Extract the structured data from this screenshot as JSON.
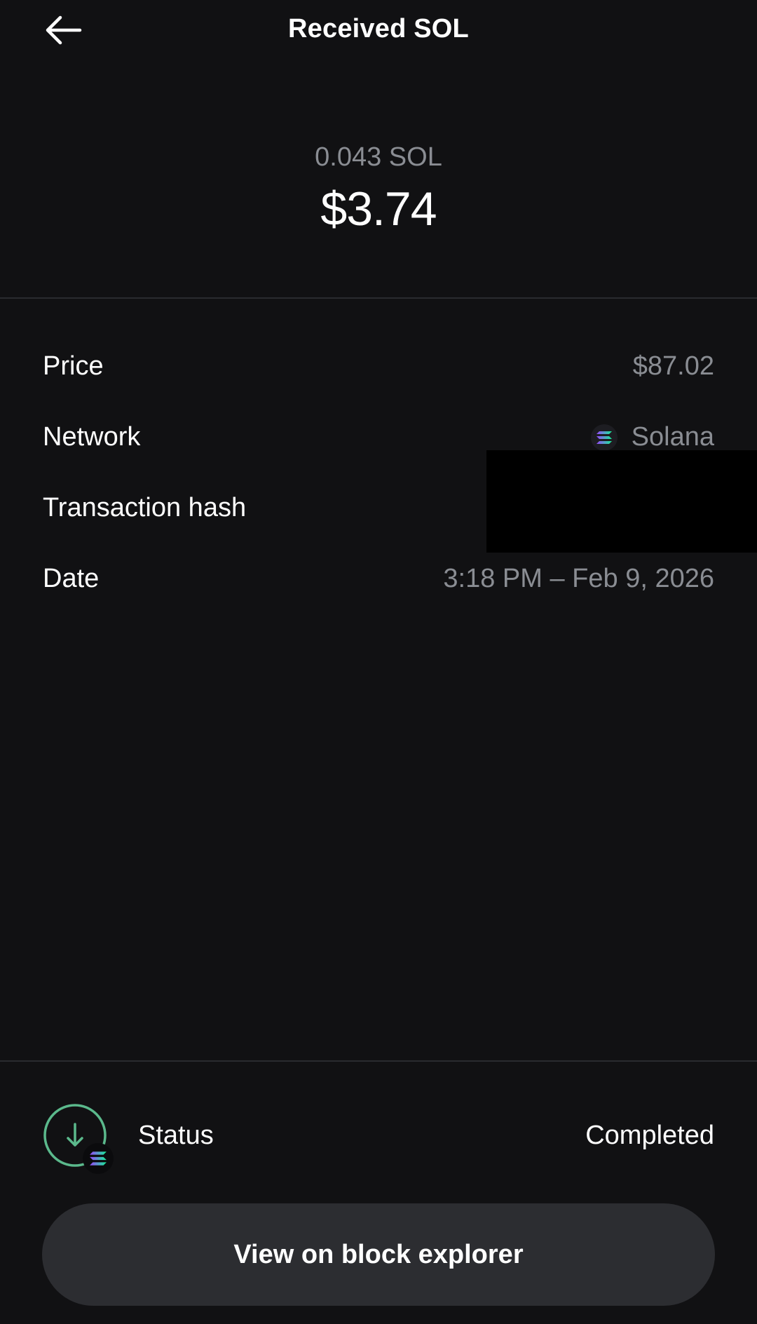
{
  "header": {
    "title": "Received SOL",
    "back_icon": "arrow-left-icon"
  },
  "amount": {
    "crypto": "0.043 SOL",
    "fiat": "$3.74"
  },
  "details": {
    "price": {
      "label": "Price",
      "value": "$87.02"
    },
    "network": {
      "label": "Network",
      "value": "Solana",
      "icon": "solana-icon"
    },
    "transaction_hash": {
      "label": "Transaction hash",
      "value": ""
    },
    "date": {
      "label": "Date",
      "value": "3:18 PM – Feb 9, 2026"
    }
  },
  "status": {
    "label": "Status",
    "value": "Completed",
    "icon": "received-arrow-icon"
  },
  "actions": {
    "explorer_label": "View on block explorer"
  },
  "colors": {
    "background": "#111113",
    "muted_text": "#8a8d93",
    "button_bg": "#2c2d31",
    "status_green": "#5bb98c",
    "solana_purple": "#9945FF",
    "solana_green": "#14F195"
  }
}
